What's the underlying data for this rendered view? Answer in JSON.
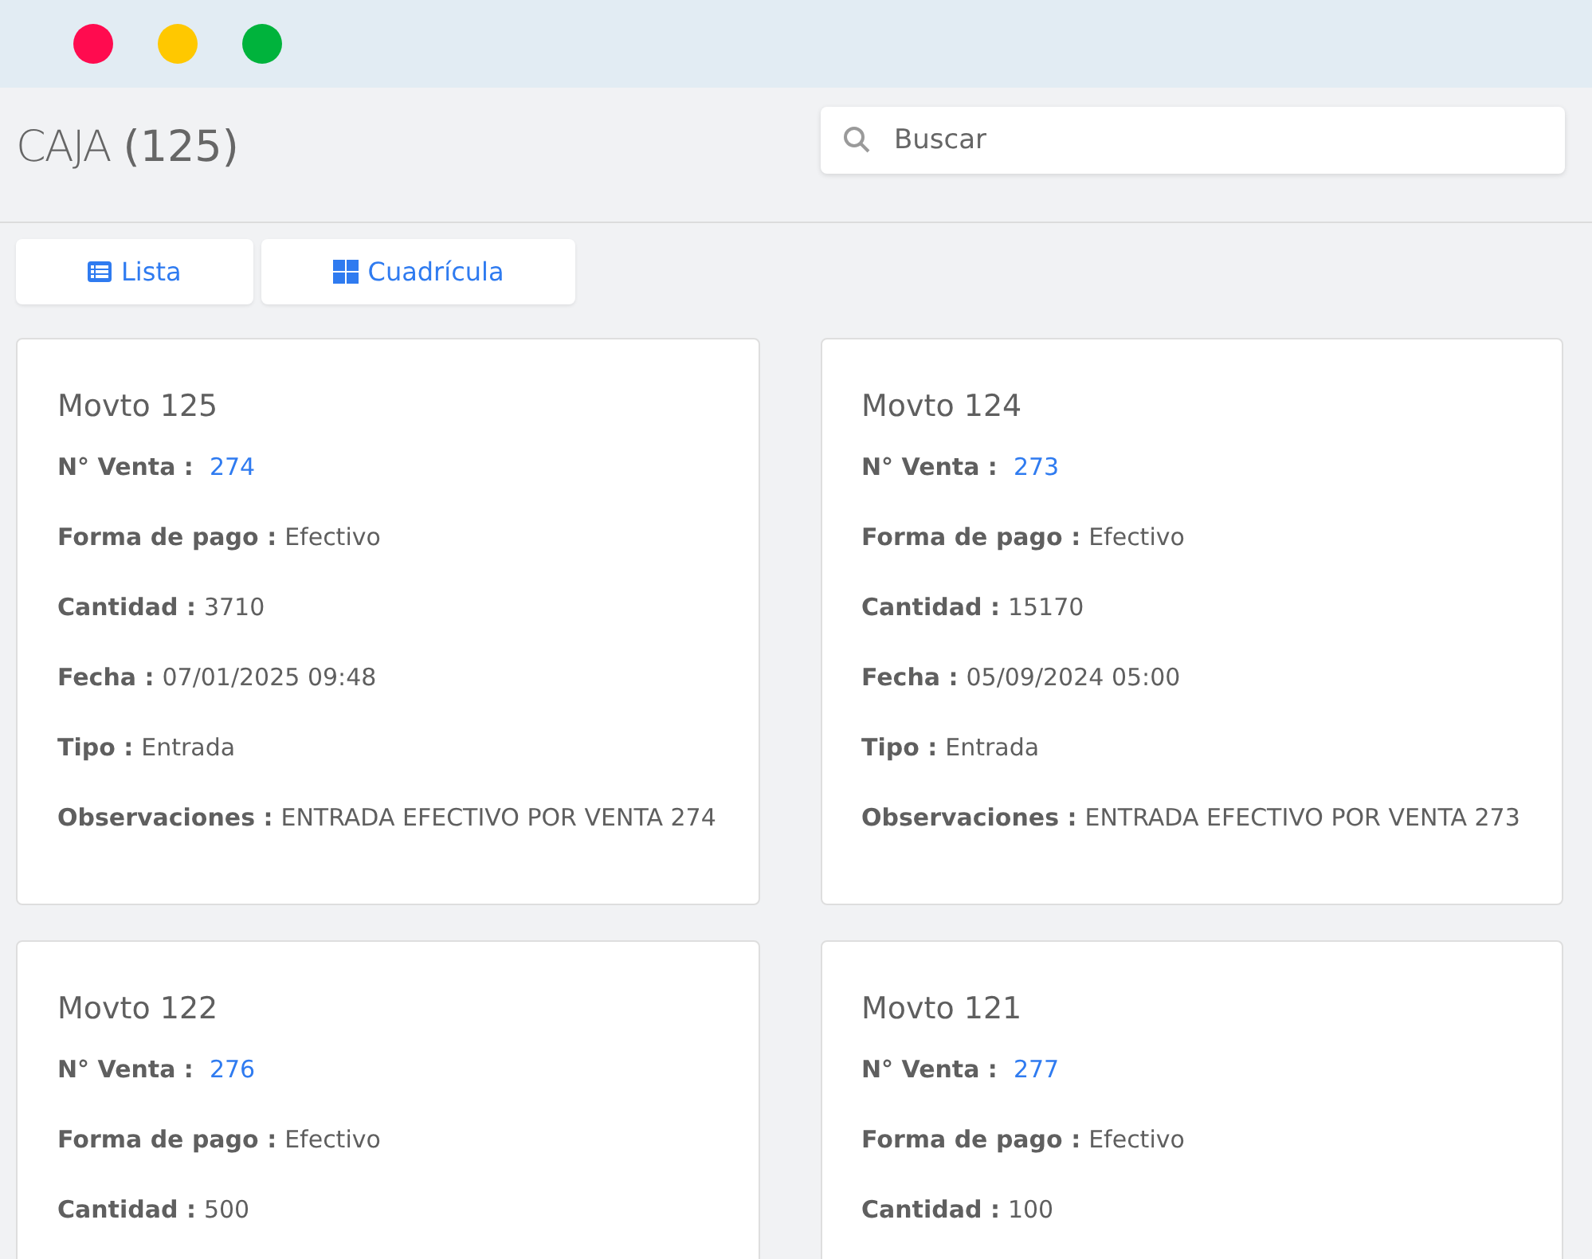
{
  "window": {
    "controls": [
      {
        "color": "#ff0b4f"
      },
      {
        "color": "#ffc800"
      },
      {
        "color": "#00b33c"
      }
    ]
  },
  "header": {
    "title": "CAJA",
    "count": "(125)",
    "search": {
      "placeholder": "Buscar"
    }
  },
  "views": [
    {
      "label": "Lista",
      "kind": "list"
    },
    {
      "label": "Cuadrícula",
      "kind": "grid"
    }
  ],
  "cards": [
    {
      "title": "Movto 125",
      "fields": [
        {
          "kind": "link",
          "label": "N° Venta :",
          "value": "274"
        },
        {
          "kind": "text",
          "label": "Forma de pago :",
          "value": "Efectivo"
        },
        {
          "kind": "text",
          "label": "Cantidad :",
          "value": "3710"
        },
        {
          "kind": "text",
          "label": "Fecha :",
          "value": "07/01/2025 09:48"
        },
        {
          "kind": "text",
          "label": "Tipo :",
          "value": "Entrada"
        },
        {
          "kind": "text",
          "label": "Observaciones :",
          "value": "ENTRADA EFECTIVO POR VENTA 274"
        }
      ]
    },
    {
      "title": "Movto 124",
      "fields": [
        {
          "kind": "link",
          "label": "N° Venta :",
          "value": "273"
        },
        {
          "kind": "text",
          "label": "Forma de pago :",
          "value": "Efectivo"
        },
        {
          "kind": "text",
          "label": "Cantidad :",
          "value": "15170"
        },
        {
          "kind": "text",
          "label": "Fecha :",
          "value": "05/09/2024 05:00"
        },
        {
          "kind": "text",
          "label": "Tipo :",
          "value": "Entrada"
        },
        {
          "kind": "text",
          "label": "Observaciones :",
          "value": "ENTRADA EFECTIVO POR VENTA 273"
        }
      ]
    },
    {
      "title": "Movto 122",
      "fields": [
        {
          "kind": "link",
          "label": "N° Venta :",
          "value": "276"
        },
        {
          "kind": "text",
          "label": "Forma de pago :",
          "value": "Efectivo"
        },
        {
          "kind": "text",
          "label": "Cantidad :",
          "value": "500"
        }
      ]
    },
    {
      "title": "Movto 121",
      "fields": [
        {
          "kind": "link",
          "label": "N° Venta :",
          "value": "277"
        },
        {
          "kind": "text",
          "label": "Forma de pago :",
          "value": "Efectivo"
        },
        {
          "kind": "text",
          "label": "Cantidad :",
          "value": "100"
        }
      ]
    }
  ]
}
